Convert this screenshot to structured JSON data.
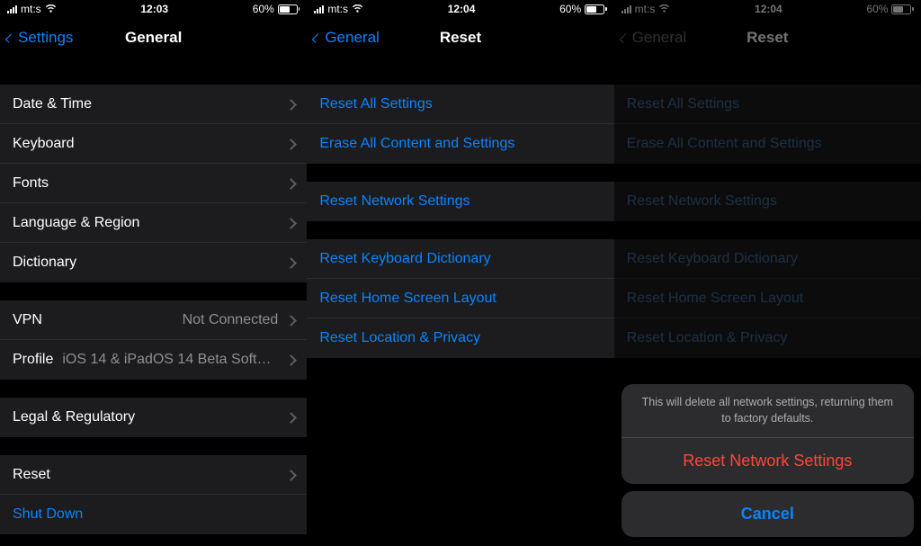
{
  "status": {
    "carrier": "mt:s",
    "battery_text": "60%",
    "battery_percent": 60
  },
  "screens": {
    "general": {
      "time": "12:03",
      "back_label": "Settings",
      "title": "General",
      "group1": {
        "date_time": "Date & Time",
        "keyboard": "Keyboard",
        "fonts": "Fonts",
        "language_region": "Language & Region",
        "dictionary": "Dictionary"
      },
      "group2": {
        "vpn_label": "VPN",
        "vpn_value": "Not Connected",
        "profile_label": "Profile",
        "profile_value": "iOS 14 & iPadOS 14 Beta Softwar..."
      },
      "group3": {
        "legal": "Legal & Regulatory"
      },
      "group4": {
        "reset": "Reset",
        "shutdown": "Shut Down"
      }
    },
    "reset": {
      "time": "12:04",
      "back_label": "General",
      "title": "Reset",
      "group1": {
        "reset_all": "Reset All Settings",
        "erase_all": "Erase All Content and Settings"
      },
      "group2": {
        "reset_network": "Reset Network Settings"
      },
      "group3": {
        "reset_keyboard": "Reset Keyboard Dictionary",
        "reset_home": "Reset Home Screen Layout",
        "reset_location": "Reset Location & Privacy"
      }
    },
    "reset_confirm": {
      "time": "12:04",
      "back_label": "General",
      "title": "Reset",
      "sheet": {
        "message": "This will delete all network settings, returning them to factory defaults.",
        "action": "Reset Network Settings",
        "cancel": "Cancel"
      }
    }
  }
}
